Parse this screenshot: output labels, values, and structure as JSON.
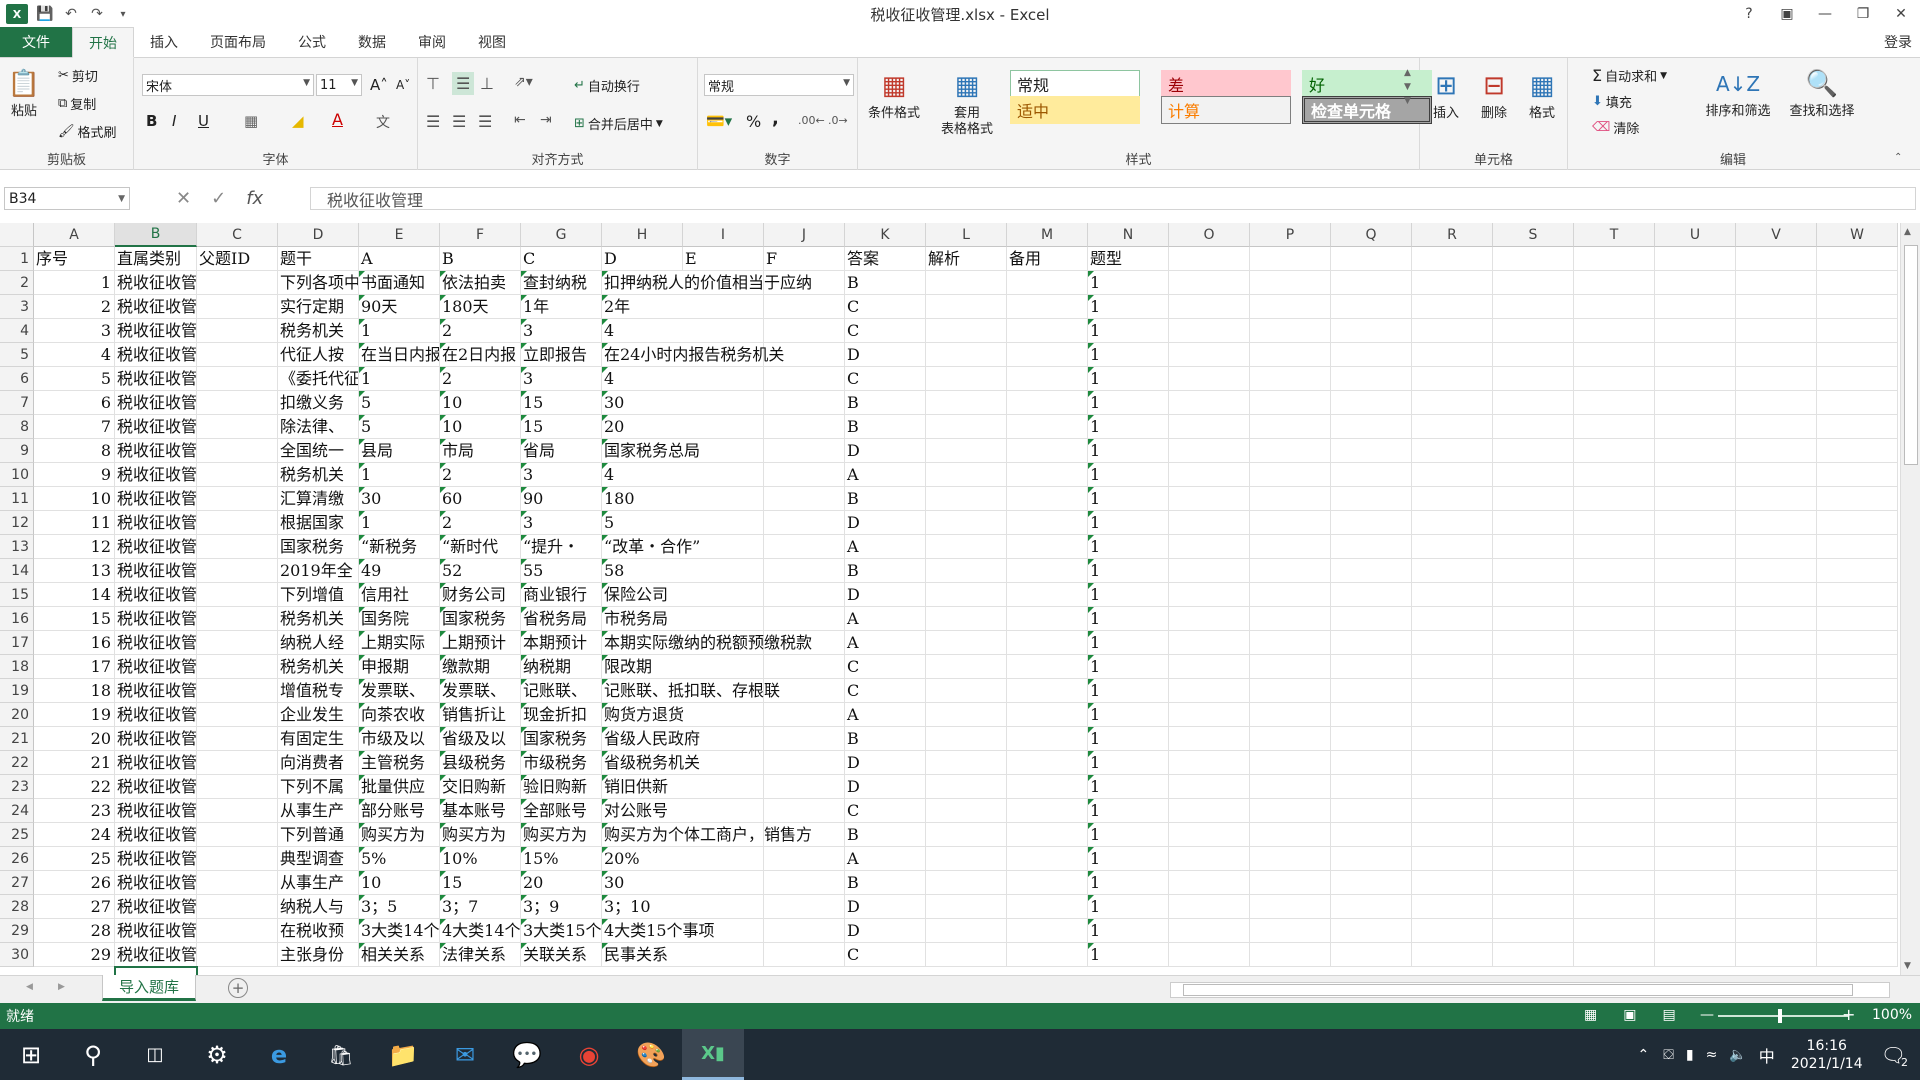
{
  "app": {
    "title": "税收征收管理.xlsx - Excel",
    "logo": "X",
    "login": "登录"
  },
  "tabs": [
    "文件",
    "开始",
    "插入",
    "页面布局",
    "公式",
    "数据",
    "审阅",
    "视图"
  ],
  "ribbon": {
    "clipboard": {
      "label": "剪贴板",
      "paste": "粘贴",
      "cut": "剪切",
      "copy": "复制",
      "format_painter": "格式刷"
    },
    "font": {
      "label": "字体",
      "name": "宋体",
      "size": "11",
      "bold": "B",
      "italic": "I",
      "underline": "U"
    },
    "alignment": {
      "label": "对齐方式",
      "wrap": "自动换行",
      "merge": "合并后居中"
    },
    "number": {
      "label": "数字",
      "format": "常规",
      "percent": "%",
      "comma": ","
    },
    "styles": {
      "label": "样式",
      "conditional": "条件格式",
      "table": "套用\n表格格式",
      "cells": [
        {
          "text": "常规",
          "bg": "#ffffff",
          "color": "#222222",
          "border": "#8ec5a0"
        },
        {
          "text": "差",
          "bg": "#ffc7ce",
          "color": "#9c0006",
          "border": "#ffc7ce"
        },
        {
          "text": "好",
          "bg": "#c6efce",
          "color": "#006100",
          "border": "#c6efce"
        },
        {
          "text": "适中",
          "bg": "#ffeb9c",
          "color": "#9c5700",
          "border": "#ffeb9c"
        },
        {
          "text": "计算",
          "bg": "#f2f2f2",
          "color": "#fa7d00",
          "border": "#7f7f7f"
        },
        {
          "text": "检查单元格",
          "bg": "#a5a5a5",
          "color": "#ffffff",
          "border": "#3f3f3f"
        }
      ]
    },
    "cells_group": {
      "label": "单元格",
      "insert": "插入",
      "delete": "删除",
      "format": "格式"
    },
    "editing": {
      "label": "编辑",
      "autosum": "自动求和",
      "fill": "填充",
      "clear": "清除",
      "sort": "排序和筛选",
      "find": "查找和选择"
    }
  },
  "formula_bar": {
    "name_box": "B34",
    "fx": "fx",
    "content": "税收征收管理"
  },
  "columns": [
    "A",
    "B",
    "C",
    "D",
    "E",
    "F",
    "G",
    "H",
    "I",
    "J",
    "K",
    "L",
    "M",
    "N",
    "O",
    "P",
    "Q",
    "R",
    "S",
    "T",
    "U",
    "V",
    "W"
  ],
  "selected_column": "B",
  "rows": [
    {
      "n": "1",
      "cells": [
        "序号",
        "直属类别",
        "父题ID",
        "题干",
        "A",
        "B",
        "C",
        "D",
        "E",
        "F",
        "答案",
        "解析",
        "备用",
        "题型"
      ]
    },
    {
      "n": "2",
      "cells": [
        "1",
        "税收征收管理",
        "",
        "下列各项中",
        "书面通知",
        "依法拍卖",
        "查封纳税",
        "扣押纳税人的价值相当于应纳",
        "",
        "",
        "B",
        "",
        "",
        "1"
      ]
    },
    {
      "n": "3",
      "cells": [
        "2",
        "税收征收管理",
        "",
        "实行定期",
        "90天",
        "180天",
        "1年",
        "2年",
        "",
        "",
        "C",
        "",
        "",
        "1"
      ]
    },
    {
      "n": "4",
      "cells": [
        "3",
        "税收征收管理",
        "",
        "税务机关",
        "1",
        "2",
        "3",
        "4",
        "",
        "",
        "C",
        "",
        "",
        "1"
      ]
    },
    {
      "n": "5",
      "cells": [
        "4",
        "税收征收管理",
        "",
        "代征人按",
        "在当日内报",
        "在2日内报",
        "立即报告",
        "在24小时内报告税务机关",
        "",
        "",
        "D",
        "",
        "",
        "1"
      ]
    },
    {
      "n": "6",
      "cells": [
        "5",
        "税收征收管理",
        "",
        "《委托代征",
        "1",
        "2",
        "3",
        "4",
        "",
        "",
        "C",
        "",
        "",
        "1"
      ]
    },
    {
      "n": "7",
      "cells": [
        "6",
        "税收征收管理",
        "",
        "扣缴义务",
        "5",
        "10",
        "15",
        "30",
        "",
        "",
        "B",
        "",
        "",
        "1"
      ]
    },
    {
      "n": "8",
      "cells": [
        "7",
        "税收征收管理",
        "",
        "除法律、",
        "5",
        "10",
        "15",
        "20",
        "",
        "",
        "B",
        "",
        "",
        "1"
      ]
    },
    {
      "n": "9",
      "cells": [
        "8",
        "税收征收管理",
        "",
        "全国统一",
        "县局",
        "市局",
        "省局",
        "国家税务总局",
        "",
        "",
        "D",
        "",
        "",
        "1"
      ]
    },
    {
      "n": "10",
      "cells": [
        "9",
        "税收征收管理",
        "",
        "税务机关",
        "1",
        "2",
        "3",
        "4",
        "",
        "",
        "A",
        "",
        "",
        "1"
      ]
    },
    {
      "n": "11",
      "cells": [
        "10",
        "税收征收管理",
        "",
        "汇算清缴",
        "30",
        "60",
        "90",
        "180",
        "",
        "",
        "B",
        "",
        "",
        "1"
      ]
    },
    {
      "n": "12",
      "cells": [
        "11",
        "税收征收管理",
        "",
        "根据国家",
        "1",
        "2",
        "3",
        "5",
        "",
        "",
        "D",
        "",
        "",
        "1"
      ]
    },
    {
      "n": "13",
      "cells": [
        "12",
        "税收征收管理",
        "",
        "国家税务",
        "“新税务",
        "“新时代",
        "“提升・",
        "“改革・合作”",
        "",
        "",
        "A",
        "",
        "",
        "1"
      ]
    },
    {
      "n": "14",
      "cells": [
        "13",
        "税收征收管理",
        "",
        "2019年全",
        "49",
        "52",
        "55",
        "58",
        "",
        "",
        "B",
        "",
        "",
        "1"
      ]
    },
    {
      "n": "15",
      "cells": [
        "14",
        "税收征收管理",
        "",
        "下列增值",
        "信用社",
        "财务公司",
        "商业银行",
        "保险公司",
        "",
        "",
        "D",
        "",
        "",
        "1"
      ]
    },
    {
      "n": "16",
      "cells": [
        "15",
        "税收征收管理",
        "",
        "税务机关",
        "国务院",
        "国家税务",
        "省税务局",
        "市税务局",
        "",
        "",
        "A",
        "",
        "",
        "1"
      ]
    },
    {
      "n": "17",
      "cells": [
        "16",
        "税收征收管理",
        "",
        "纳税人经",
        "上期实际",
        "上期预计",
        "本期预计",
        "本期实际缴纳的税额预缴税款",
        "",
        "",
        "A",
        "",
        "",
        "1"
      ]
    },
    {
      "n": "18",
      "cells": [
        "17",
        "税收征收管理",
        "",
        "税务机关",
        "申报期",
        "缴款期",
        "纳税期",
        "限改期",
        "",
        "",
        "C",
        "",
        "",
        "1"
      ]
    },
    {
      "n": "19",
      "cells": [
        "18",
        "税收征收管理",
        "",
        "增值税专",
        "发票联、",
        "发票联、",
        "记账联、",
        "记账联、抵扣联、存根联",
        "",
        "",
        "C",
        "",
        "",
        "1"
      ]
    },
    {
      "n": "20",
      "cells": [
        "19",
        "税收征收管理",
        "",
        "企业发生",
        "向茶农收",
        "销售折让",
        "现金折扣",
        "购货方退货",
        "",
        "",
        "A",
        "",
        "",
        "1"
      ]
    },
    {
      "n": "21",
      "cells": [
        "20",
        "税收征收管理",
        "",
        "有固定生",
        "市级及以",
        "省级及以",
        "国家税务",
        "省级人民政府",
        "",
        "",
        "B",
        "",
        "",
        "1"
      ]
    },
    {
      "n": "22",
      "cells": [
        "21",
        "税收征收管理",
        "",
        "向消费者",
        "主管税务",
        "县级税务",
        "市级税务",
        "省级税务机关",
        "",
        "",
        "D",
        "",
        "",
        "1"
      ]
    },
    {
      "n": "23",
      "cells": [
        "22",
        "税收征收管理",
        "",
        "下列不属",
        "批量供应",
        "交旧购新",
        "验旧购新",
        "销旧供新",
        "",
        "",
        "D",
        "",
        "",
        "1"
      ]
    },
    {
      "n": "24",
      "cells": [
        "23",
        "税收征收管理",
        "",
        "从事生产",
        "部分账号",
        "基本账号",
        "全部账号",
        "对公账号",
        "",
        "",
        "C",
        "",
        "",
        "1"
      ]
    },
    {
      "n": "25",
      "cells": [
        "24",
        "税收征收管理",
        "",
        "下列普通",
        "购买方为",
        "购买方为",
        "购买方为",
        "购买方为个体工商户，销售方",
        "",
        "",
        "B",
        "",
        "",
        "1"
      ]
    },
    {
      "n": "26",
      "cells": [
        "25",
        "税收征收管理",
        "",
        "典型调查",
        "5%",
        "10%",
        "15%",
        "20%",
        "",
        "",
        "A",
        "",
        "",
        "1"
      ]
    },
    {
      "n": "27",
      "cells": [
        "26",
        "税收征收管理",
        "",
        "从事生产",
        "10",
        "15",
        "20",
        "30",
        "",
        "",
        "B",
        "",
        "",
        "1"
      ]
    },
    {
      "n": "28",
      "cells": [
        "27",
        "税收征收管理",
        "",
        "纳税人与",
        "3；5",
        "3；7",
        "3；9",
        "3；10",
        "",
        "",
        "D",
        "",
        "",
        "1"
      ]
    },
    {
      "n": "29",
      "cells": [
        "28",
        "税收征收管理",
        "",
        "在税收预",
        "3大类14个",
        "4大类14个",
        "3大类15个",
        "4大类15个事项",
        "",
        "",
        "D",
        "",
        "",
        "1"
      ]
    },
    {
      "n": "30",
      "cells": [
        "29",
        "税收征收管理",
        "",
        "主张身份",
        "相关关系",
        "法律关系",
        "关联关系",
        "民事关系",
        "",
        "",
        "C",
        "",
        "",
        "1"
      ]
    }
  ],
  "sheet_tab": "导入题库",
  "status": {
    "ready": "就绪",
    "zoom": "100%"
  },
  "taskbar": {
    "time": "16:16",
    "date": "2021/1/14",
    "ime": "中",
    "notif": "2"
  }
}
